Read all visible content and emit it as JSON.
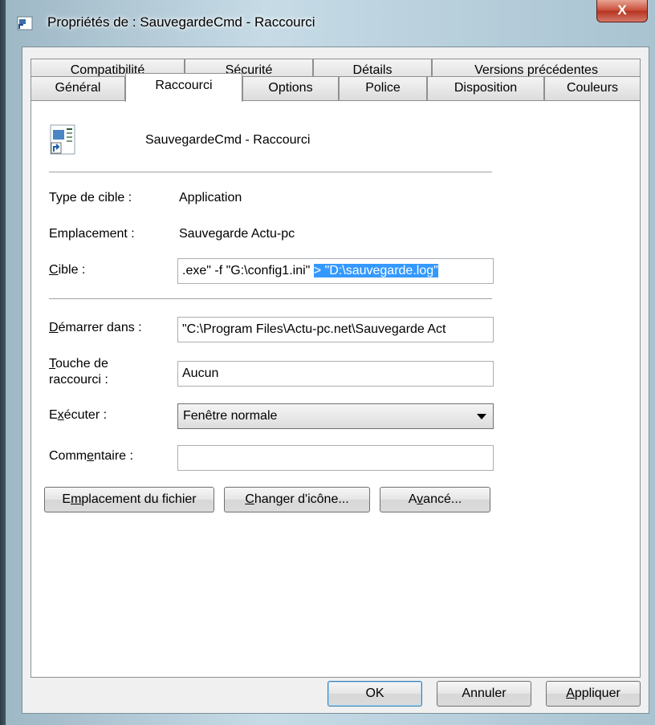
{
  "window": {
    "title": "Propriétés de : SauvegardeCmd - Raccourci",
    "close_label": "X"
  },
  "tabs_back": [
    {
      "label": "Compatibilité"
    },
    {
      "label": "Sécurité"
    },
    {
      "label": "Détails"
    },
    {
      "label": "Versions précédentes"
    }
  ],
  "tabs_front": [
    {
      "label": "Général"
    },
    {
      "label": "Raccourci"
    },
    {
      "label": "Options"
    },
    {
      "label": "Police"
    },
    {
      "label": "Disposition"
    },
    {
      "label": "Couleurs"
    }
  ],
  "active_tab": "Raccourci",
  "shortcut": {
    "name": "SauvegardeCmd - Raccourci",
    "icon": "shortcut-file-icon"
  },
  "fields": {
    "target_type_label": "Type de cible :",
    "target_type_value": "Application",
    "location_label": "Emplacement :",
    "location_value": "Sauvegarde Actu-pc",
    "target_label": "Cible :",
    "target_value_plain": ".exe\" -f \"G:\\config1.ini\" ",
    "target_value_selected": "> \"D:\\sauvegarde.log\"",
    "start_in_label": "Démarrer dans :",
    "start_in_value": "\"C:\\Program Files\\Actu-pc.net\\Sauvegarde Act",
    "hotkey_label_line1": "Touche de",
    "hotkey_label_line2": "raccourci :",
    "hotkey_value": "Aucun",
    "run_label": "Exécuter :",
    "run_value": "Fenêtre normale",
    "comment_label": "Commentaire :",
    "comment_value": ""
  },
  "buttons": {
    "open_location": "Emplacement du fichier",
    "change_icon": "Changer d'icône...",
    "advanced": "Avancé...",
    "ok": "OK",
    "cancel": "Annuler",
    "apply": "Appliquer"
  }
}
